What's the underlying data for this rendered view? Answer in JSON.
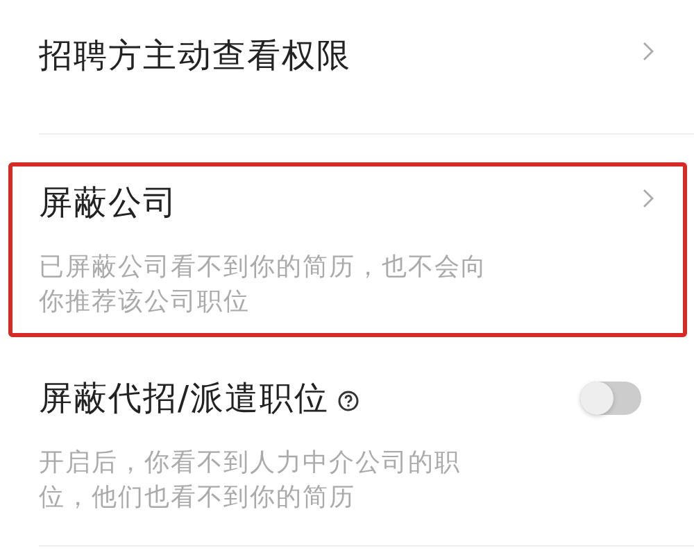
{
  "settings": [
    {
      "kind": "link",
      "title": "招聘方主动查看权限",
      "highlighted": false
    },
    {
      "kind": "link",
      "title": "屏蔽公司",
      "highlighted": true,
      "description": [
        "已屏蔽公司看不到你的简历，也不会向",
        "你推荐该公司职位"
      ]
    },
    {
      "kind": "toggle",
      "title": "屏蔽代招/派遣职位",
      "help": true,
      "on": false,
      "highlighted": false,
      "description": [
        "开启后，你看不到人力中介公司的职",
        "位，他们也看不到你的简历"
      ]
    }
  ]
}
